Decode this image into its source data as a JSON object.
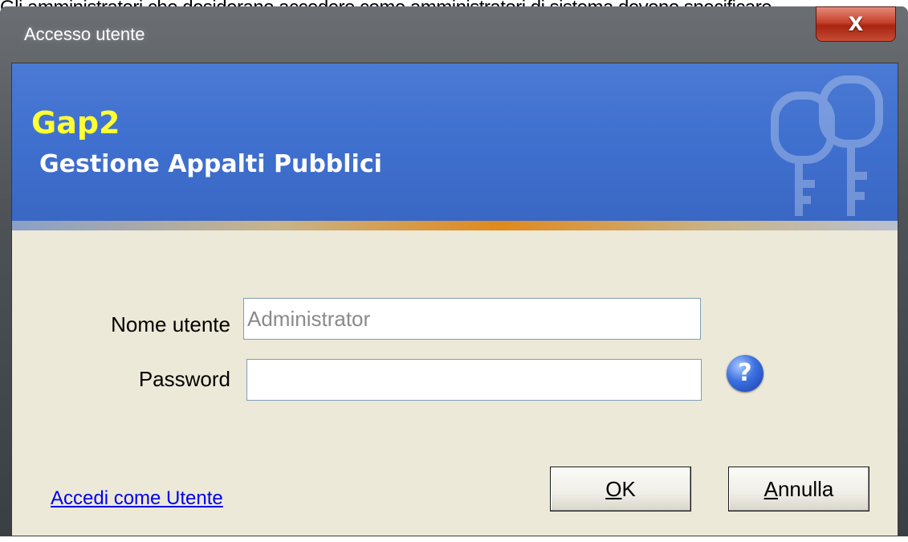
{
  "top_strip_text": "Gli amministratori che desiderano accedere come amministratori di sistema devono specificare",
  "window": {
    "title": "Accesso utente",
    "close_glyph": "X"
  },
  "banner": {
    "app_name": "Gap2",
    "app_subtitle": "Gestione Appalti Pubblici"
  },
  "form": {
    "username_label": "Nome utente",
    "username_value": "Administrator",
    "password_label": "Password",
    "password_value": "",
    "help_glyph": "?"
  },
  "footer": {
    "user_link": "Accedi come Utente",
    "ok_access": "O",
    "ok_rest": "K",
    "cancel_access": "A",
    "cancel_rest": "nnulla"
  },
  "colors": {
    "banner_blue": "#4a7ad4",
    "brand_yellow": "#ffff33",
    "dialog_bg": "#ece9d8",
    "close_red": "#c7412c",
    "link_blue": "#0000ee"
  },
  "icons": {
    "close": "close-icon",
    "help": "help-icon",
    "keys": "keys-icon"
  }
}
